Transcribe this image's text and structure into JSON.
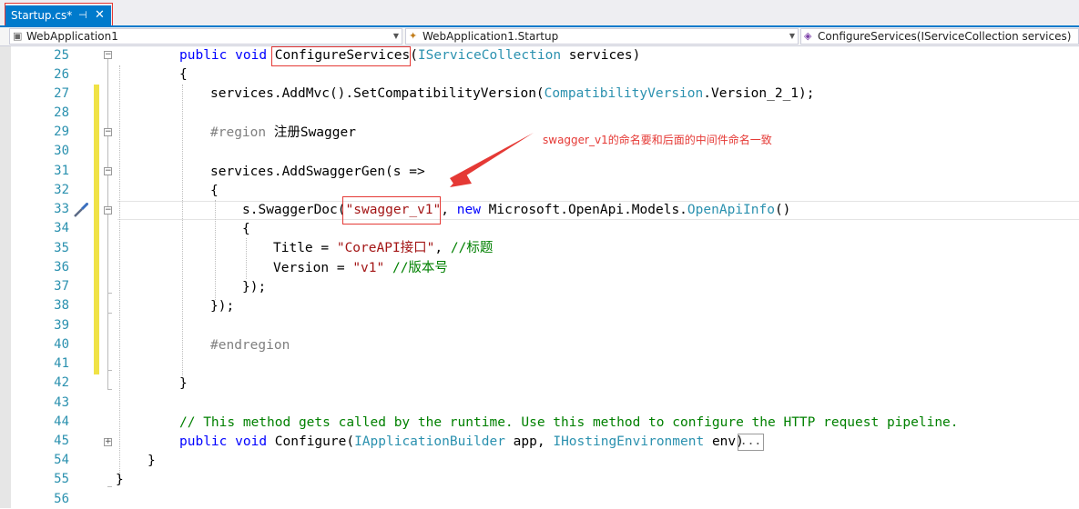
{
  "tab": {
    "title": "Startup.cs*",
    "pin_icon": "pin-icon",
    "close_icon": "close-icon"
  },
  "navbar": {
    "project": "WebApplication1",
    "class": "WebApplication1.Startup",
    "member": "ConfigureServices(IServiceCollection services)"
  },
  "line_numbers": [
    "25",
    "26",
    "27",
    "28",
    "29",
    "30",
    "31",
    "32",
    "33",
    "34",
    "35",
    "36",
    "37",
    "38",
    "39",
    "40",
    "41",
    "42",
    "43",
    "44",
    "45",
    "54",
    "55",
    "56"
  ],
  "code": {
    "l25": {
      "kw1": "public",
      "kw2": "void",
      "method": "ConfigureServices",
      "p1": "(",
      "type": "IServiceCollection",
      "rest": " services)"
    },
    "l26": "{",
    "l27": {
      "a": "services.AddMvc().SetCompatibilityVersion(",
      "type": "CompatibilityVersion",
      "b": ".Version_2_1);"
    },
    "l29": {
      "region": "#region",
      "name": " 注册Swagger"
    },
    "l31": "services.AddSwaggerGen(s =>",
    "l32": "{",
    "l33": {
      "a": "s.SwaggerDoc(",
      "str": "\"swagger_v1\"",
      "b": ", ",
      "kw": "new",
      "c": " Microsoft.OpenApi.Models.",
      "type": "OpenApiInfo",
      "d": "()"
    },
    "l34": "{",
    "l35": {
      "a": "Title = ",
      "str": "\"CoreAPI接口\"",
      "b": ", ",
      "cm": "//标题"
    },
    "l36": {
      "a": "Version = ",
      "str": "\"v1\"",
      "b": " ",
      "cm": "//版本号"
    },
    "l37": "});",
    "l38": "});",
    "l40": "#endregion",
    "l42": "}",
    "l44": "// This method gets called by the runtime. Use this method to configure the HTTP request pipeline.",
    "l45": {
      "kw1": "public",
      "kw2": "void",
      "a": " Configure(",
      "type1": "IApplicationBuilder",
      "b": " app, ",
      "type2": "IHostingEnvironment",
      "c": " env)"
    },
    "l54": "}",
    "l55": "}",
    "collapsed": "..."
  },
  "annotation": "swagger_v1的命名要和后面的中间件命名一致",
  "colors": {
    "accent": "#007acc",
    "annotation": "#e53935",
    "change_bar": "#f0e246"
  }
}
